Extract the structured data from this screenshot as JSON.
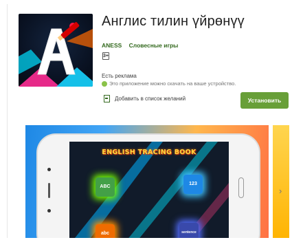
{
  "app": {
    "title": "Англис тилин үйрөнүү",
    "developer": "ANESS",
    "category": "Словесные игры",
    "rating_badge": "3+",
    "ads_notice": "Есть реклама",
    "device_notice": "Это приложение можно скачать на ваше устройство.",
    "wishlist_label": "Добавить в список желаний",
    "install_label": "Установить"
  },
  "screenshot": {
    "book_title": "ENGLISH TRACING BOOK",
    "tiles": [
      "ABC",
      "123",
      "abc",
      "sentence"
    ]
  },
  "colors": {
    "accent_green": "#689f38",
    "meta_green": "#33691e"
  },
  "icons": {
    "rating": "age-rating-icon",
    "info": "info-icon",
    "wishlist": "bookmark-icon",
    "next": "chevron-right-icon"
  }
}
